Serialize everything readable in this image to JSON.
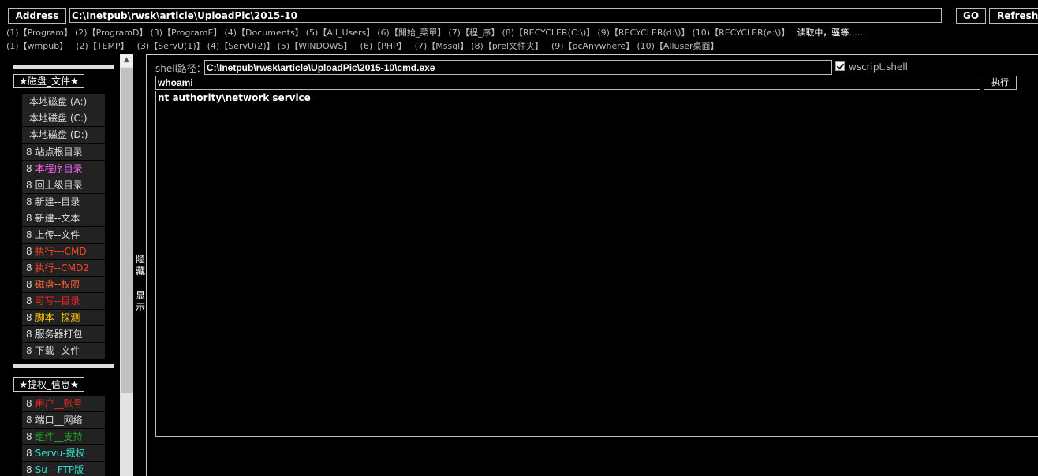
{
  "address": {
    "label": "Address",
    "value": "C:\\Inetpub\\rwsk\\article\\UploadPic\\2015-10",
    "go_label": "GO",
    "refresh_label": "Refresh"
  },
  "quick_links_row1": [
    "(1)【Program】",
    "(2)【ProgramD】",
    "(3)【ProgramE】",
    "(4)【Documents】",
    "(5)【All_Users】",
    "(6)【開始_菜單】",
    "(7)【程_序】",
    "(8)【RECYCLER(C:\\)】",
    "(9)【RECYCLER(d:\\)】",
    "(10)【RECYCLER(e:\\)】"
  ],
  "loading_text": "读取中，骚等......",
  "quick_links_row2": [
    "(1)【wmpub】",
    "(2)【TEMP】",
    "(3)【ServU(1)】",
    "(4)【ServU(2)】",
    "(5)【WINDOWS】",
    "(6)【PHP】",
    "(7)【Mssql】",
    "(8)【prel文件夹】",
    "(9)【pcAnywhere】",
    "(10)【Alluser桌面】"
  ],
  "sidebar": {
    "section1_title": "★磁盘_文件★",
    "drives": [
      "本地磁盘 (A:)",
      "本地磁盘 (C:)",
      "本地磁盘 (D:)"
    ],
    "tools": [
      {
        "num": "8",
        "label": "站点根目录",
        "color": "#dddddd"
      },
      {
        "num": "8",
        "label": "本程序目录",
        "color": "#ff66ff"
      },
      {
        "num": "8",
        "label": "回上级目录",
        "color": "#dddddd"
      },
      {
        "num": "8",
        "label": "新建--目录",
        "color": "#dddddd"
      },
      {
        "num": "8",
        "label": "新建--文本",
        "color": "#dddddd"
      },
      {
        "num": "8",
        "label": "上传--文件",
        "color": "#dddddd"
      },
      {
        "num": "8",
        "label": "执行---CMD",
        "color": "#ff4422"
      },
      {
        "num": "8",
        "label": "执行--CMD2",
        "color": "#ff4422"
      },
      {
        "num": "8",
        "label": "磁盘--权限",
        "color": "#ff6633"
      },
      {
        "num": "8",
        "label": "可写--目录",
        "color": "#ff2222"
      },
      {
        "num": "8",
        "label": "脚本--探测",
        "color": "#ffcc00"
      },
      {
        "num": "8",
        "label": "服务器打包",
        "color": "#dddddd"
      },
      {
        "num": "8",
        "label": "下载--文件",
        "color": "#dddddd"
      }
    ],
    "section2_title": "★提权_信息★",
    "info_items": [
      {
        "num": "8",
        "label": "用户__账号",
        "color": "#ff2222"
      },
      {
        "num": "8",
        "label": "端口__网络",
        "color": "#dddddd"
      },
      {
        "num": "8",
        "label": "组件__支持",
        "color": "#22aa22"
      },
      {
        "num": "8",
        "label": "Servu-提权",
        "color": "#33ddcc"
      },
      {
        "num": "8",
        "label": "Su---FTP版",
        "color": "#33ddcc"
      }
    ]
  },
  "toggle": {
    "hide_label": "隐藏",
    "show_label": "显示"
  },
  "shell": {
    "path_label": "shell路径：",
    "path_value": "C:\\Inetpub\\rwsk\\article\\UploadPic\\2015-10\\cmd.exe",
    "wscript_label": "wscript.shell",
    "wscript_checked": true,
    "command_value": "whoami",
    "exec_label": "执行",
    "output": "nt authority\\network service"
  }
}
